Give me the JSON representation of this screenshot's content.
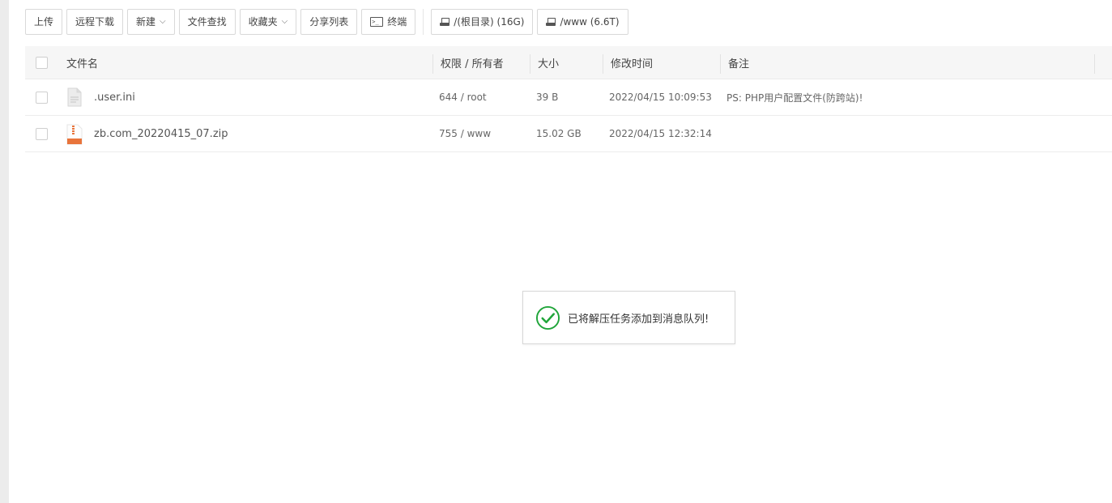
{
  "toolbar": {
    "upload": "上传",
    "remote_download": "远程下载",
    "new": "新建",
    "file_search": "文件查找",
    "favorites": "收藏夹",
    "share_list": "分享列表",
    "terminal": "终端",
    "disk_root": "/(根目录) (16G)",
    "disk_www": "/www (6.6T)"
  },
  "table": {
    "headers": {
      "name": "文件名",
      "perm_owner": "权限 / 所有者",
      "size": "大小",
      "mtime": "修改时间",
      "note": "备注"
    },
    "rows": [
      {
        "icon": "text-file-icon",
        "name": ".user.ini",
        "perm_owner": "644 / root",
        "size": "39 B",
        "mtime": "2022/04/15 10:09:53",
        "note": "PS: PHP用户配置文件(防跨站)!"
      },
      {
        "icon": "zip-file-icon",
        "name": "zb.com_20220415_07.zip",
        "perm_owner": "755 / www",
        "size": "15.02 GB",
        "mtime": "2022/04/15 12:32:14",
        "note": ""
      }
    ]
  },
  "toast": {
    "icon": "check-circle-icon",
    "message": "已将解压任务添加到消息队列!",
    "accent": "#20a53a"
  }
}
